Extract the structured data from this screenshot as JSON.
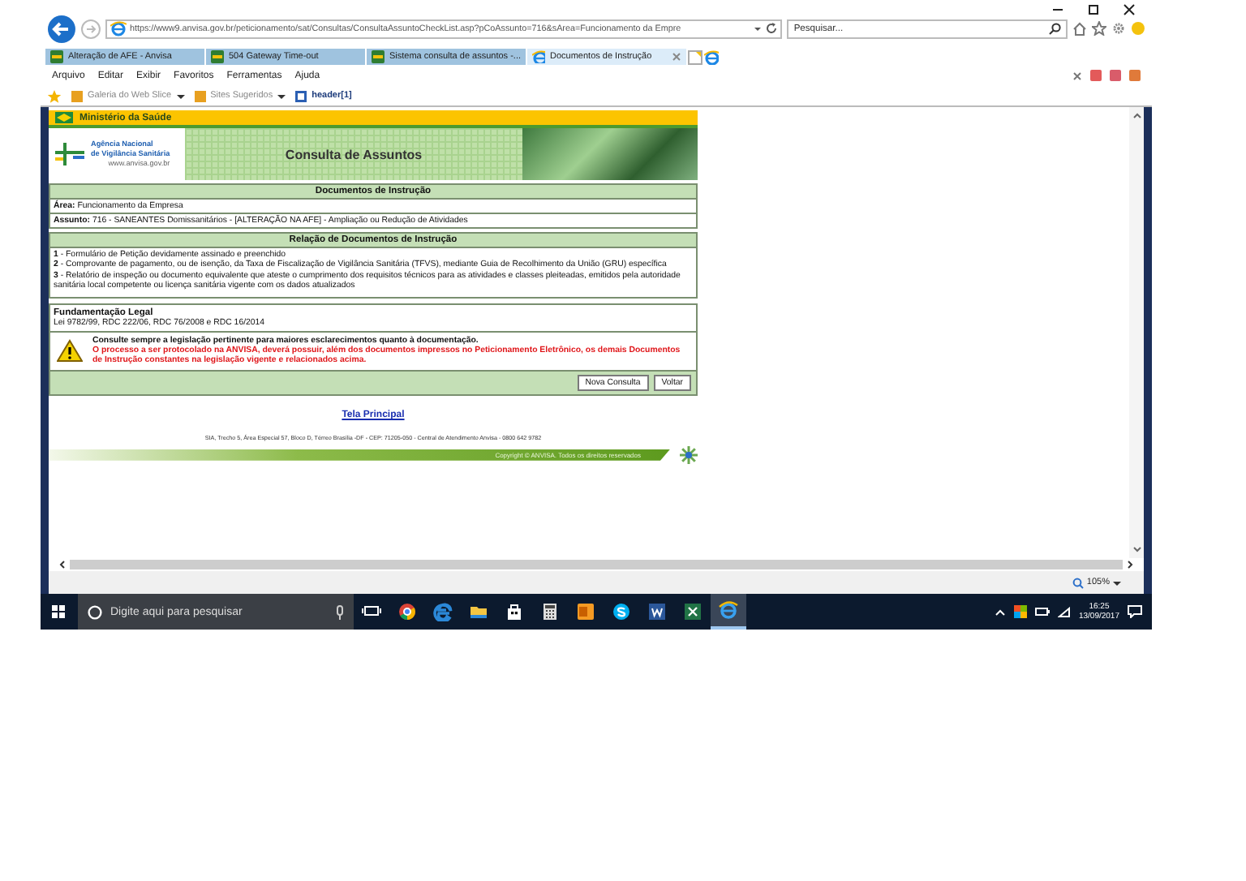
{
  "browser": {
    "url": "https://www9.anvisa.gov.br/peticionamento/sat/Consultas/ConsultaAssuntoCheckList.asp?pCoAssunto=716&sArea=Funcionamento da Empre",
    "search_placeholder": "Pesquisar...",
    "tabs": [
      {
        "label": "Alteração de AFE - Anvisa",
        "selected": false
      },
      {
        "label": "504 Gateway Time-out",
        "selected": false
      },
      {
        "label": "Sistema consulta de assuntos -...",
        "selected": false
      },
      {
        "label": "Documentos de Instrução",
        "selected": true
      }
    ],
    "menu": [
      "Arquivo",
      "Editar",
      "Exibir",
      "Favoritos",
      "Ferramentas",
      "Ajuda"
    ],
    "favorites": [
      {
        "label": "Galeria do Web Slice",
        "kind": "dropdown"
      },
      {
        "label": "Sites Sugeridos",
        "kind": "dropdown"
      },
      {
        "label": "header[1]",
        "kind": "link"
      }
    ],
    "zoom": "105%"
  },
  "page": {
    "agency_bar": "Ministério da Saúde",
    "logo_lines": [
      "Agência Nacional",
      "de Vigilância Sanitária",
      "www.anvisa.gov.br"
    ],
    "banner_title": "Consulta de Assuntos",
    "documents": {
      "heading": "Documentos de Instrução",
      "fields": [
        {
          "label": "Área:",
          "value": "Funcionamento da Empresa"
        },
        {
          "label": "Assunto:",
          "value": "716 - SANEANTES Domissanitários - [ALTERAÇÃO NA AFE] - Ampliação ou Redução de Atividades"
        }
      ]
    },
    "list": {
      "heading": "Relação de Documentos de Instrução",
      "items": [
        {
          "number": "1",
          "text": "- Formulário de Petição devidamente assinado e preenchido"
        },
        {
          "number": "2",
          "text": "- Comprovante de pagamento, ou de isenção, da Taxa de Fiscalização de Vigilância Sanitária (TFVS), mediante Guia de Recolhimento da União (GRU) específica"
        },
        {
          "number": "3",
          "text": "- Relatório de inspeção ou documento equivalente que ateste o cumprimento dos requisitos técnicos para as atividades e classes pleiteadas,  emitidos pela autoridade sanitária local competente ou licença sanitária vigente com os dados atualizados"
        }
      ]
    },
    "legal": {
      "title": "Fundamentação Legal",
      "text": "Lei 9782/99, RDC 222/06, RDC 76/2008 e RDC 16/2014"
    },
    "warning": {
      "note": "Consulte sempre a legislação pertinente para maiores esclarecimentos quanto à documentação.",
      "alert": "O processo a ser protocolado na ANVISA, deverá possuir, além dos documentos impressos no Peticionamento Eletrônico, os demais Documentos de Instrução constantes na legislação vigente e relacionados acima."
    },
    "buttons": [
      "Nova Consulta",
      "Voltar"
    ],
    "home_link": "Tela Principal",
    "address": "SIA, Trecho 5, Área Especial 57, Bloco D, Térreo Brasília -DF - CEP: 71205-050 - Central de Atendimento Anvisa - 0800 642 9782",
    "copyright": "Copyright © ANVISA. Todos os direitos reservados"
  },
  "taskbar": {
    "search_placeholder": "Digite aqui para pesquisar",
    "apps": [
      {
        "kind": "taskview",
        "active": false
      },
      {
        "kind": "chrome",
        "active": false
      },
      {
        "kind": "edge",
        "active": false
      },
      {
        "kind": "explorer",
        "active": false
      },
      {
        "kind": "store",
        "active": false
      },
      {
        "kind": "calculator",
        "active": false
      },
      {
        "kind": "outlook",
        "active": false
      },
      {
        "kind": "skype",
        "active": false
      },
      {
        "kind": "word",
        "active": false
      },
      {
        "kind": "excel",
        "active": false
      },
      {
        "kind": "ie",
        "active": true
      }
    ],
    "time": "16:25",
    "date": "13/09/2017"
  }
}
